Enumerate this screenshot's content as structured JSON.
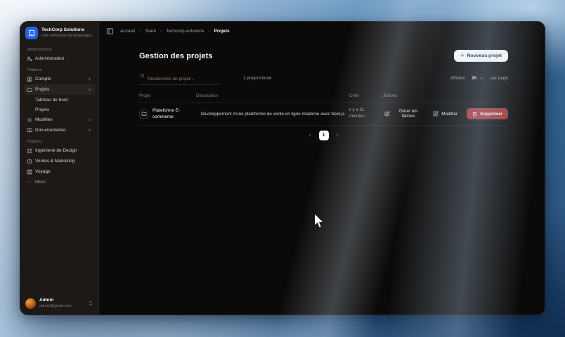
{
  "window": {
    "sidebar": {
      "org": {
        "name": "TechCorp Solutions",
        "subtitle": "Une entreprise de développe..."
      },
      "sections": [
        {
          "label": "Administration",
          "items": [
            {
              "label": "Administration",
              "icon": "user-gear-icon"
            }
          ]
        },
        {
          "label": "Platform",
          "items": [
            {
              "label": "Compte",
              "icon": "square-user-icon"
            },
            {
              "label": "Projets",
              "icon": "folder-icon",
              "children": [
                {
                  "label": "Tableau de bord"
                },
                {
                  "label": "Projets"
                }
              ]
            },
            {
              "label": "Modèles",
              "icon": "gear-icon"
            },
            {
              "label": "Documentation",
              "icon": "book-open-icon"
            }
          ]
        },
        {
          "label": "Projects",
          "items": [
            {
              "label": "Ingénierie de Design",
              "icon": "frame-icon"
            },
            {
              "label": "Ventes & Marketing",
              "icon": "clock-icon"
            },
            {
              "label": "Voyage",
              "icon": "map-icon"
            },
            {
              "label": "More",
              "icon": "ellipsis-icon"
            }
          ]
        }
      ],
      "user": {
        "name": "Admin",
        "email": "admin@gmail.com"
      }
    },
    "breadcrumbs": {
      "items": [
        "Accueil",
        "Team",
        "Techcorp-solutions",
        "Projets"
      ],
      "separator": "›"
    },
    "main": {
      "title": "Gestion des projets",
      "new_project": {
        "plus": "+",
        "label": "Nouveau projet"
      },
      "toolbar": {
        "search_placeholder": "Rechercher un projet...",
        "result_count": "1 projet trouvé",
        "page_size_prefix": "Afficher",
        "page_size_value": "20",
        "page_size_suffix": "par page"
      },
      "table": {
        "headers": {
          "project": "Projet",
          "description": "Description",
          "created": "Créé",
          "actions": "Actions"
        },
        "rows": [
          {
            "name": "Plateforme E-commerce",
            "description": "Développement d'une plateforme de vente en ligne moderne avec Next.js",
            "created": "il y a 31 minutes",
            "manage_tasks": "Gérer les tâches",
            "edit": "Modifier",
            "delete": "Supprimer"
          }
        ]
      },
      "pagination": {
        "prev": "‹",
        "current": "1",
        "next": "›"
      }
    }
  },
  "glyphs": {
    "ellipsis": "⋯"
  },
  "colors": {
    "accent_blue": "#2563eb",
    "danger_red": "#a13030",
    "sidebar_bg": "#1c1917",
    "main_bg": "#0c0a09",
    "button_light": "#fafafa"
  }
}
